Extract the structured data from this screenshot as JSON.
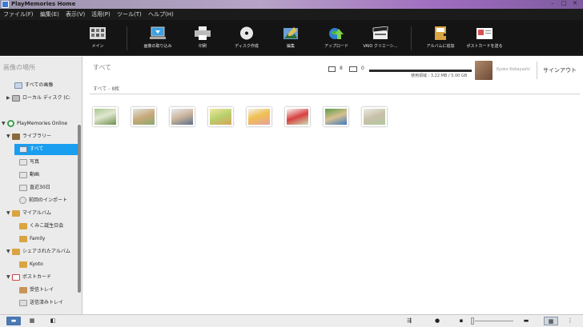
{
  "window": {
    "title": "PlayMemories Home",
    "controls": [
      "–",
      "□",
      "✕"
    ]
  },
  "menu": [
    "ファイル(F)",
    "編集(E)",
    "表示(V)",
    "活用(P)",
    "ツール(T)",
    "ヘルプ(H)"
  ],
  "toolbar": [
    {
      "label": "メイン",
      "icon": "main-icon"
    },
    {
      "label": "画像の取り込み",
      "icon": "import-icon"
    },
    {
      "label": "印刷",
      "icon": "print-icon"
    },
    {
      "label": "ディスク作成",
      "icon": "disc-icon"
    },
    {
      "label": "編集",
      "icon": "edit-icon"
    },
    {
      "label": "アップロード",
      "icon": "upload-icon"
    },
    {
      "label": "VAIO クリエーシ...",
      "icon": "vaio-create-icon"
    },
    {
      "label": "アルバムに追加",
      "icon": "album-add-icon"
    },
    {
      "label": "ポストカードを送る",
      "icon": "postcard-icon"
    }
  ],
  "sidebar": {
    "heading": "画像の場所",
    "items": [
      {
        "label": "すべての画像",
        "icon": "all-images-icon"
      },
      {
        "label": "ローカル ディスク (C:",
        "icon": "disk-icon"
      },
      {
        "label": "PlayMemories Online",
        "icon": "online-icon"
      },
      {
        "label": "ライブラリー",
        "icon": "library-icon"
      },
      {
        "label": "すべて",
        "icon": "all-icon"
      },
      {
        "label": "写真",
        "icon": "photo-icon"
      },
      {
        "label": "動画",
        "icon": "video-icon"
      },
      {
        "label": "直近30日",
        "icon": "calendar-icon"
      },
      {
        "label": "前回のインポート",
        "icon": "last-import-icon"
      },
      {
        "label": "マイアルバム",
        "icon": "my-album-icon"
      },
      {
        "label": "くみこ誕生日会",
        "icon": "album-icon"
      },
      {
        "label": "Family",
        "icon": "album-icon"
      },
      {
        "label": "シェアされたアルバム",
        "icon": "shared-album-icon"
      },
      {
        "label": "Kyoto",
        "icon": "album-icon"
      },
      {
        "label": "ポストカード",
        "icon": "postcard-folder-icon"
      },
      {
        "label": "受信トレイ",
        "icon": "inbox-icon"
      },
      {
        "label": "送信済みトレイ",
        "icon": "sent-icon"
      }
    ]
  },
  "content": {
    "title": "すべて",
    "count_line": "すべて - 8枚",
    "photo_count": "8",
    "video_count": "0",
    "storage_text": "使用領域 : 3.22 MB / 5.00 GB",
    "account_name": "Kyoko Kobayashi",
    "signout": "サインアウト",
    "thumbnail_count": 8
  },
  "status": {
    "zoom_fraction": 0.05
  }
}
